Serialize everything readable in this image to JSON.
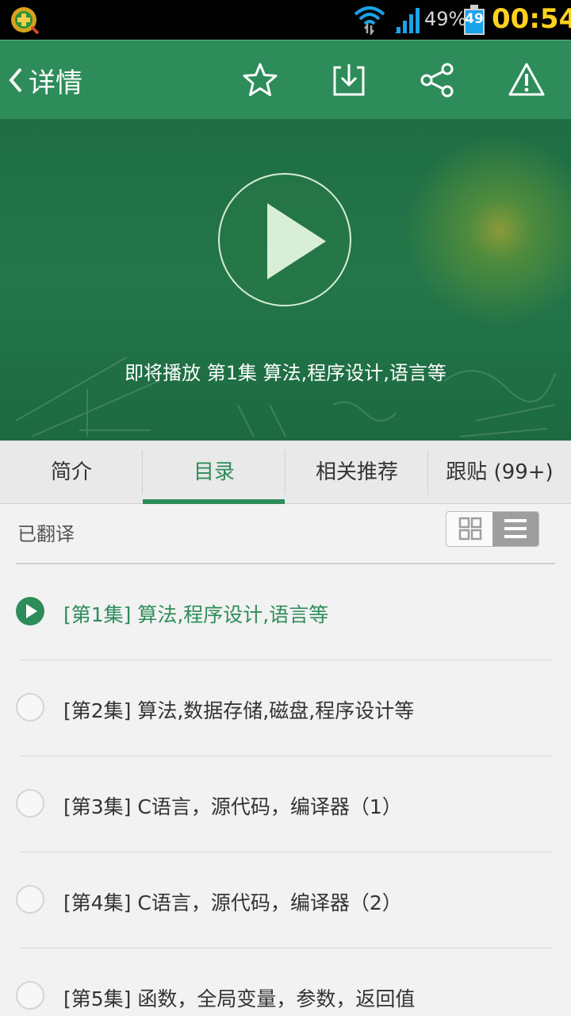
{
  "status_bar": {
    "battery_percent": "49%",
    "battery_level": "49",
    "time": "00:54",
    "icons": [
      "app-icon",
      "wifi-icon",
      "signal-icon",
      "battery-icon"
    ]
  },
  "header": {
    "back_label": "详情",
    "actions": [
      "star-icon",
      "download-icon",
      "share-icon",
      "warning-icon"
    ]
  },
  "video": {
    "upcoming_text": "即将播放 第1集 算法,程序设计,语言等"
  },
  "tabs": [
    {
      "label": "简介",
      "active": false
    },
    {
      "label": "目录",
      "active": true
    },
    {
      "label": "相关推荐",
      "active": false
    },
    {
      "label": "跟贴 (99+)",
      "active": false
    }
  ],
  "catalog": {
    "filter_label": "已翻译",
    "view_mode": "list"
  },
  "episodes": [
    {
      "label": "[第1集] 算法,程序设计,语言等",
      "playing": true
    },
    {
      "label": "[第2集] 算法,数据存储,磁盘,程序设计等",
      "playing": false
    },
    {
      "label": "[第3集] C语言，源代码，编译器（1）",
      "playing": false
    },
    {
      "label": "[第4集] C语言，源代码，编译器（2）",
      "playing": false
    },
    {
      "label": "[第5集] 函数，全局变量，参数，返回值",
      "playing": false
    }
  ],
  "colors": {
    "accent": "#2e8c5a",
    "time": "#ffd21f",
    "battery": "#1aa3e8"
  }
}
